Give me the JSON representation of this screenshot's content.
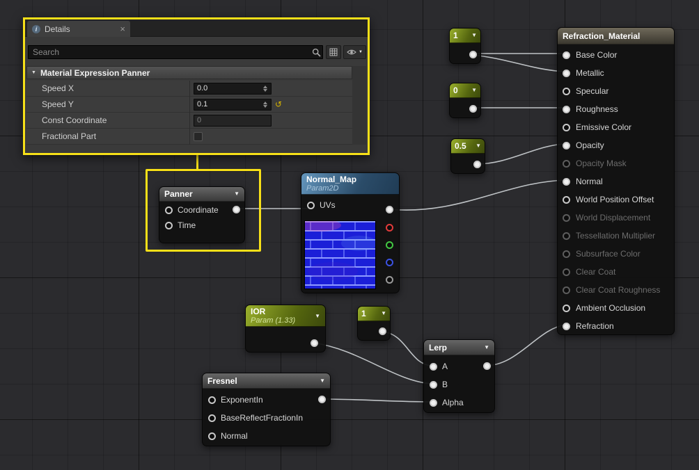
{
  "icons": {
    "close": "×",
    "dropdown": "▼",
    "section_arrow": "▼",
    "reset": "↺",
    "info": "i"
  },
  "colors": {
    "highlight": "#f7e018",
    "wire": "#ccd0d4",
    "param_green": "#9ab02c",
    "texture_blue": "#1b1fd8"
  },
  "details": {
    "tab_label": "Details",
    "search_placeholder": "Search",
    "section_title": "Material Expression Panner",
    "rows": [
      {
        "label": "Speed X",
        "value": "0.0"
      },
      {
        "label": "Speed Y",
        "value": "0.1"
      },
      {
        "label": "Const Coordinate",
        "value": "0"
      },
      {
        "label": "Fractional Part",
        "value": ""
      }
    ]
  },
  "nodes": {
    "panner": {
      "title": "Panner",
      "inputs": [
        "Coordinate",
        "Time"
      ]
    },
    "normal_map": {
      "title": "Normal_Map",
      "subtitle": "Param2D",
      "uv_label": "UVs"
    },
    "const_one_top": {
      "value": "1"
    },
    "const_zero": {
      "value": "0"
    },
    "const_half": {
      "value": "0.5"
    },
    "ior": {
      "title": "IOR",
      "subtitle": "Param (1.33)"
    },
    "const_one_lerp": {
      "value": "1"
    },
    "lerp": {
      "title": "Lerp",
      "inputs": [
        "A",
        "B",
        "Alpha"
      ]
    },
    "fresnel": {
      "title": "Fresnel",
      "inputs": [
        "ExponentIn",
        "BaseReflectFractionIn",
        "Normal"
      ]
    },
    "material": {
      "title": "Refraction_Material",
      "inputs": [
        {
          "label": "Base Color",
          "state": "connected"
        },
        {
          "label": "Metallic",
          "state": "connected"
        },
        {
          "label": "Specular",
          "state": "open"
        },
        {
          "label": "Roughness",
          "state": "connected"
        },
        {
          "label": "Emissive Color",
          "state": "open"
        },
        {
          "label": "Opacity",
          "state": "connected"
        },
        {
          "label": "Opacity Mask",
          "state": "disabled"
        },
        {
          "label": "Normal",
          "state": "connected"
        },
        {
          "label": "World Position Offset",
          "state": "open"
        },
        {
          "label": "World Displacement",
          "state": "disabled"
        },
        {
          "label": "Tessellation Multiplier",
          "state": "disabled"
        },
        {
          "label": "Subsurface Color",
          "state": "disabled"
        },
        {
          "label": "Clear Coat",
          "state": "disabled"
        },
        {
          "label": "Clear Coat Roughness",
          "state": "disabled"
        },
        {
          "label": "Ambient Occlusion",
          "state": "open"
        },
        {
          "label": "Refraction",
          "state": "connected"
        }
      ]
    }
  }
}
